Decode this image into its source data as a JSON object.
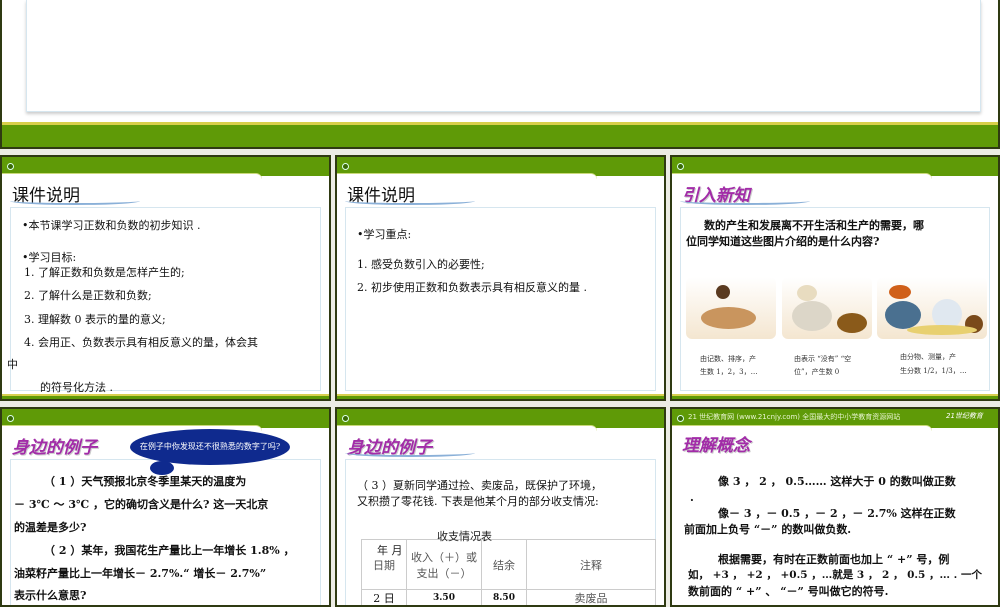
{
  "slides": [
    {
      "id": "slide-1"
    },
    {
      "title": "课件说明",
      "lines": [
        "•本节课学习正数和负数的初步知识 .",
        "•学习目标:",
        "1. 了解正数和负数是怎样产生的;",
        "2. 了解什么是正数和负数;",
        "3. 理解数 0 表示的量的意义;",
        "4. 会用正、负数表示具有相反意义的量，体会其",
        "中",
        "的符号化方法 ."
      ]
    },
    {
      "title": "课件说明",
      "lines": [
        "•学习重点:",
        "1. 感受负数引入的必要性;",
        "2. 初步使用正数和负数表示具有相反意义的量 ."
      ]
    },
    {
      "title": "引入新知",
      "lines": [
        "数的产生和发展离不开生活和生产的需要，哪",
        "位同学知道这些图片介绍的是什么内容?"
      ],
      "captions": [
        "由记数、排序，产",
        "生数 1，2，3，…",
        "由表示 “没有” “空",
        "位”，产生数 0",
        "由分物、测量，产",
        "生分数 1/2，1/3，…"
      ]
    },
    {
      "title": "身边的例子",
      "callout": "在例子中你发现还不很熟悉的数字了吗?",
      "lines": [
        "（ 1 ）天气预报北京冬季里某天的温度为",
        "－ 3℃ ～ 3℃ ，它的确切含义是什么? 这一天北京",
        "的温差是多少?",
        "（ 2 ）某年，我国花生产量比上一年增长 1.8% ，",
        "油菜籽产量比上一年增长－ 2.7%.“ 增长－ 2.7%”",
        "表示什么意思?"
      ]
    },
    {
      "title": "身边的例子",
      "lines": [
        "（ 3 ）夏新同学通过捡、卖废品，既保护了环境，",
        "又积攒了零花钱. 下表是他某个月的部分收支情况:"
      ],
      "table": {
        "caption": "收支情况表",
        "caption2": "年   月",
        "headers": [
          "日期",
          "收入（＋）或支出（－）",
          "结余",
          "注释"
        ],
        "rows": [
          [
            "2 日",
            "3.50",
            "8.50",
            "卖废品"
          ]
        ]
      }
    },
    {
      "header_text": "21 世纪教育网 (www.21cnjy.com)  全国最大的中小学教育资源网站",
      "logo": "21世纪教育",
      "title": "理解概念",
      "lines": [
        "像 3 ， 2 ， 0.5…… 这样大于 0 的数叫做正数",
        ".",
        "像－ 3 ，－ 0.5 ，－ 2 ，－ 2.7% 这样在正数",
        "前面加上负号 “－” 的数叫做负数.",
        "根据需要，有时在正数前面也加上 “ +” 号，例",
        "如， +3 ， +2 ， +0.5 ，…就是 3 ， 2 ， 0.5 ，… . 一个",
        "数前面的 “ +” 、 “－” 号叫做它的符号."
      ]
    }
  ]
}
